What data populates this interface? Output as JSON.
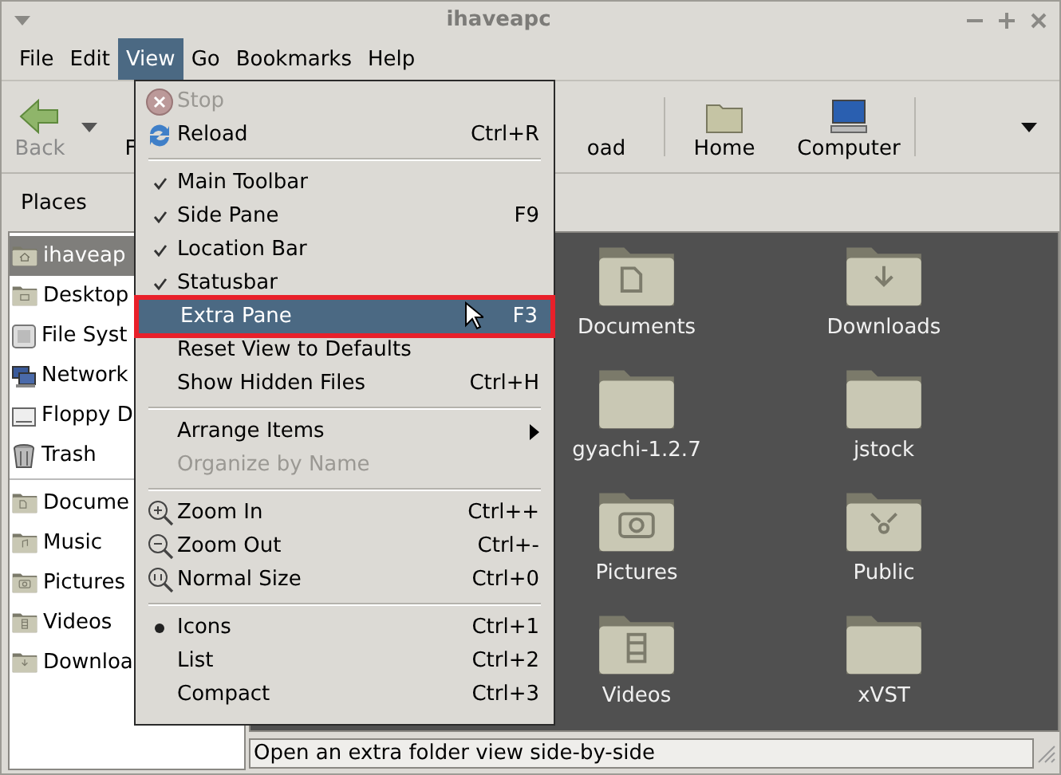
{
  "window": {
    "title": "ihaveapc"
  },
  "menubar": [
    {
      "label": "File",
      "selected": false
    },
    {
      "label": "Edit",
      "selected": false
    },
    {
      "label": "View",
      "selected": true
    },
    {
      "label": "Go",
      "selected": false
    },
    {
      "label": "Bookmarks",
      "selected": false
    },
    {
      "label": "Help",
      "selected": false
    }
  ],
  "toolbar": [
    {
      "kind": "back",
      "label": "Back",
      "disabled": true
    },
    {
      "kind": "forward",
      "label": "F",
      "disabled": false
    },
    {
      "kind": "reload",
      "label": "oad",
      "disabled": false
    },
    {
      "kind": "home",
      "label": "Home",
      "disabled": false
    },
    {
      "kind": "computer",
      "label": "Computer",
      "disabled": false
    }
  ],
  "sidebar": {
    "title": "Places",
    "groups": [
      [
        {
          "kind": "home",
          "label": "ihaveap",
          "selected": true
        },
        {
          "kind": "desktop",
          "label": "Desktop",
          "selected": false
        },
        {
          "kind": "drive",
          "label": "File Syst",
          "selected": false
        },
        {
          "kind": "network",
          "label": "Network",
          "selected": false
        },
        {
          "kind": "floppy",
          "label": "Floppy D",
          "selected": false
        },
        {
          "kind": "trash",
          "label": "Trash",
          "selected": false
        }
      ],
      [
        {
          "kind": "documents",
          "label": "Docume",
          "selected": false
        },
        {
          "kind": "music",
          "label": "Music",
          "selected": false
        },
        {
          "kind": "pictures",
          "label": "Pictures",
          "selected": false
        },
        {
          "kind": "videos",
          "label": "Videos",
          "selected": false
        },
        {
          "kind": "downloads",
          "label": "Downloa",
          "selected": false
        }
      ]
    ]
  },
  "view_menu": {
    "groups": [
      [
        {
          "kind": "stop",
          "label": "Stop",
          "disabled": true,
          "selected": false
        },
        {
          "kind": "reload",
          "label": "Reload",
          "shortcut": "Ctrl+R",
          "disabled": false,
          "selected": false
        }
      ],
      [
        {
          "kind": "check",
          "label": "Main Toolbar",
          "checked": true,
          "disabled": false,
          "selected": false
        },
        {
          "kind": "check",
          "label": "Side Pane",
          "shortcut": "F9",
          "checked": true,
          "disabled": false,
          "selected": false
        },
        {
          "kind": "check",
          "label": "Location Bar",
          "checked": true,
          "disabled": false,
          "selected": false
        },
        {
          "kind": "check",
          "label": "Statusbar",
          "checked": true,
          "disabled": false,
          "selected": false
        },
        {
          "kind": "check",
          "label": "Extra Pane",
          "shortcut": "F3",
          "checked": false,
          "disabled": false,
          "selected": true
        },
        {
          "kind": "plain",
          "label": "Reset View to Defaults",
          "disabled": false,
          "selected": false
        },
        {
          "kind": "check",
          "label": "Show Hidden Files",
          "shortcut": "Ctrl+H",
          "checked": false,
          "disabled": false,
          "selected": false
        }
      ],
      [
        {
          "kind": "submenu",
          "label": "Arrange Items",
          "disabled": false,
          "selected": false
        },
        {
          "kind": "plain",
          "label": "Organize by Name",
          "disabled": true,
          "selected": false
        }
      ],
      [
        {
          "kind": "zoomin",
          "label": "Zoom In",
          "shortcut": "Ctrl++",
          "disabled": false,
          "selected": false
        },
        {
          "kind": "zoomout",
          "label": "Zoom Out",
          "shortcut": "Ctrl+-",
          "disabled": false,
          "selected": false
        },
        {
          "kind": "zoomreset",
          "label": "Normal Size",
          "shortcut": "Ctrl+0",
          "disabled": false,
          "selected": false
        }
      ],
      [
        {
          "kind": "radio",
          "label": "Icons",
          "shortcut": "Ctrl+1",
          "checked": true,
          "disabled": false,
          "selected": false
        },
        {
          "kind": "radio",
          "label": "List",
          "shortcut": "Ctrl+2",
          "checked": false,
          "disabled": false,
          "selected": false
        },
        {
          "kind": "radio",
          "label": "Compact",
          "shortcut": "Ctrl+3",
          "checked": false,
          "disabled": false,
          "selected": false
        }
      ]
    ]
  },
  "files": [
    {
      "kind": "documents",
      "label": "Documents"
    },
    {
      "kind": "downloads",
      "label": "Downloads"
    },
    {
      "kind": "plain",
      "label": "gyachi-1.2.7"
    },
    {
      "kind": "plain",
      "label": "jstock"
    },
    {
      "kind": "pictures",
      "label": "Pictures"
    },
    {
      "kind": "public",
      "label": "Public"
    },
    {
      "kind": "videos",
      "label": "Videos"
    },
    {
      "kind": "plain",
      "label": "xVST"
    }
  ],
  "status_bar": "Open an extra folder view side-by-side"
}
